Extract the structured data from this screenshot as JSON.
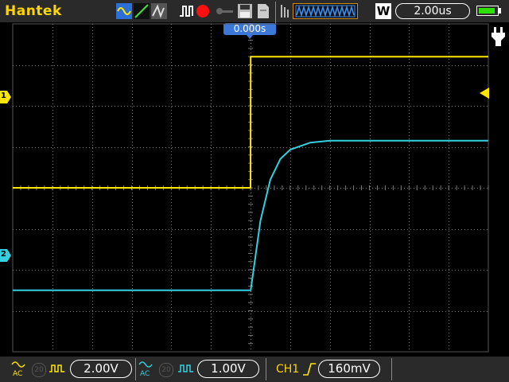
{
  "brand": "Hantek",
  "toolbar": {
    "wave_icons": [
      "sine-wave-icon",
      "ramp-wave-icon",
      "pulse-wave-icon",
      "square-wave-icon"
    ],
    "record_icon": "record-icon",
    "key_icon": "key-icon",
    "save_icon": "floppy-disk-icon",
    "file_icon": "document-icon",
    "memory_badge": "W",
    "timebase": "2.00us",
    "battery_level_pct": 90
  },
  "trigger_position_label": "0.000s",
  "channel_markers": {
    "ch1": "1",
    "ch2": "2"
  },
  "colors": {
    "ch1": "#ffe600",
    "ch2": "#35d0e0",
    "trigger_badge": "#3b78d8",
    "grid": "#7a7a7a",
    "topbar": "#2a2a2a",
    "brand": "#ffd400"
  },
  "bottom": {
    "ch1_coupling": "AC",
    "ch1_bw_icon": "20",
    "ch1_scale": "2.00V",
    "ch2_coupling": "AC",
    "ch2_bw_icon": "20",
    "ch2_scale": "1.00V",
    "trigger_source": "CH1",
    "trigger_edge_icon": "rising-edge-icon",
    "trigger_level": "160mV"
  },
  "chart_data": {
    "type": "line",
    "xlabel": "",
    "ylabel": "",
    "timebase_per_div": "2.00us",
    "x_divisions": 12,
    "y_divisions": 8,
    "x": [
      -12,
      -10,
      -8,
      -6,
      -4,
      -2,
      0,
      0.01,
      0.5,
      1,
      1.5,
      2,
      3,
      4,
      6,
      8,
      10,
      12
    ],
    "series": [
      {
        "name": "CH1",
        "color": "#ffe600",
        "values": [
          0,
          0,
          0,
          0,
          0,
          0,
          0,
          3.2,
          3.2,
          3.2,
          3.2,
          3.2,
          3.2,
          3.2,
          3.2,
          3.2,
          3.2,
          3.2
        ]
      },
      {
        "name": "CH2",
        "color": "#35d0e0",
        "values": [
          -2.5,
          -2.5,
          -2.5,
          -2.5,
          -2.5,
          -2.5,
          -2.5,
          -2.5,
          -0.8,
          0.2,
          0.7,
          0.93,
          1.1,
          1.15,
          1.15,
          1.15,
          1.15,
          1.15
        ]
      }
    ]
  }
}
